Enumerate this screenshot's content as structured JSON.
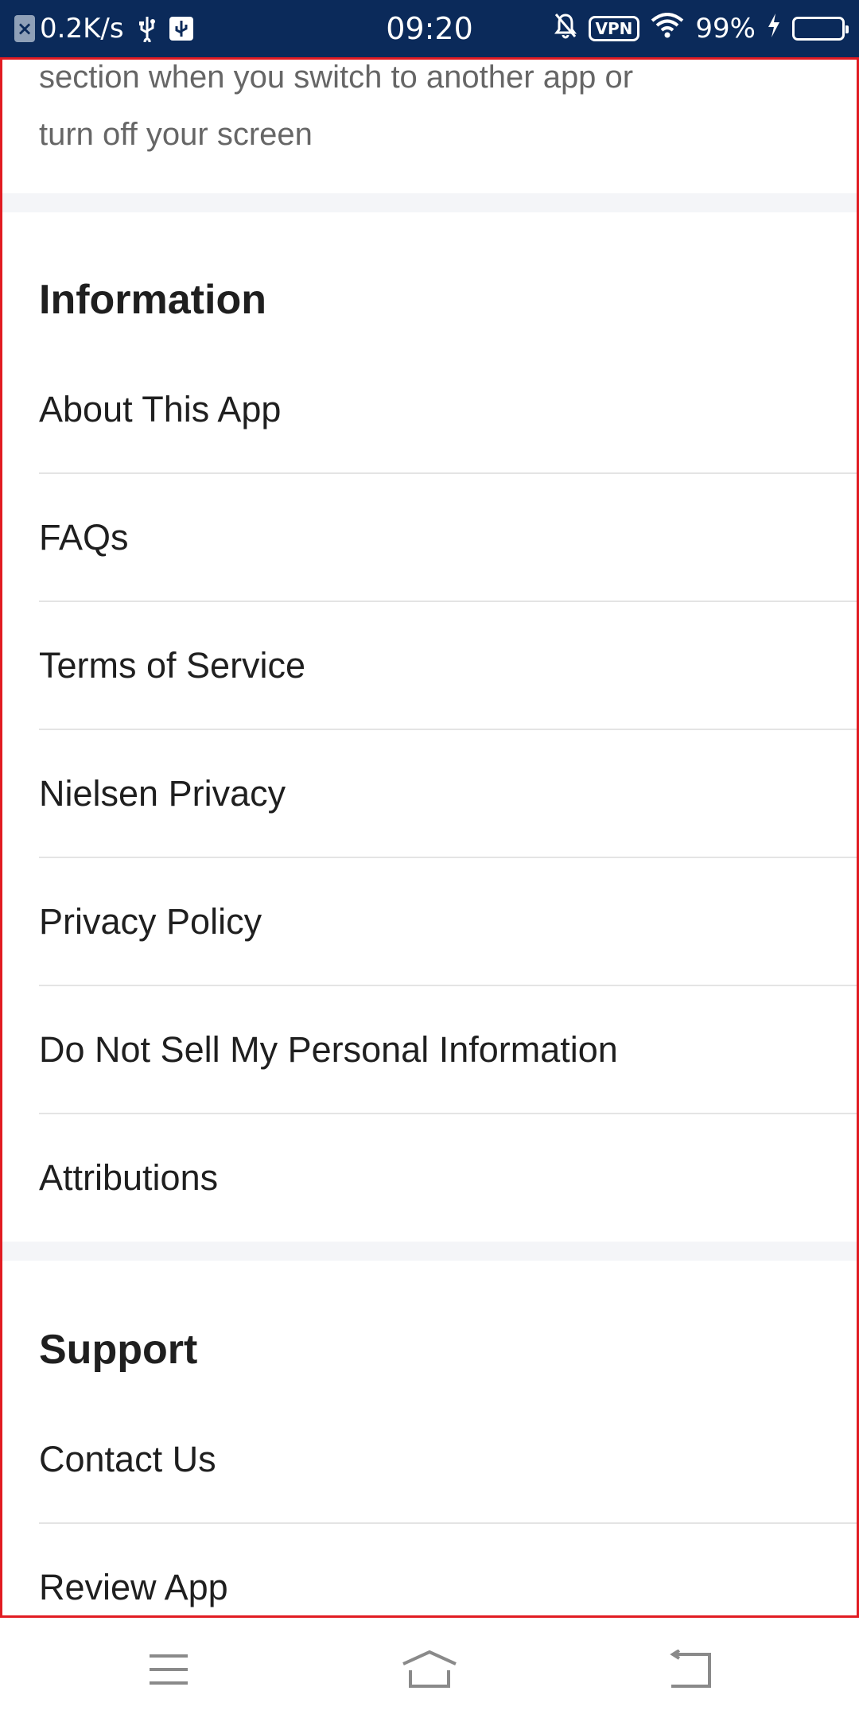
{
  "status_bar": {
    "net_speed": "0.2K/s",
    "time": "09:20",
    "vpn_label": "VPN",
    "battery": "99%"
  },
  "content": {
    "top_text_line1": "section when you switch to another app or",
    "top_text_line2": "turn off your screen",
    "sections": {
      "information": {
        "title": "Information",
        "items": [
          "About This App",
          "FAQs",
          "Terms of Service",
          "Nielsen Privacy",
          "Privacy Policy",
          "Do Not Sell My Personal Information",
          "Attributions"
        ]
      },
      "support": {
        "title": "Support",
        "items": [
          "Contact Us",
          "Review App"
        ]
      }
    }
  },
  "nav_bar": {
    "icons": [
      "menu-icon",
      "home-icon",
      "back-icon"
    ]
  },
  "colors": {
    "status_bar_bg": "#0b2a5a",
    "frame_border": "#e11b22",
    "section_gap": "#f4f5f8",
    "divider": "#e4e4e4"
  }
}
